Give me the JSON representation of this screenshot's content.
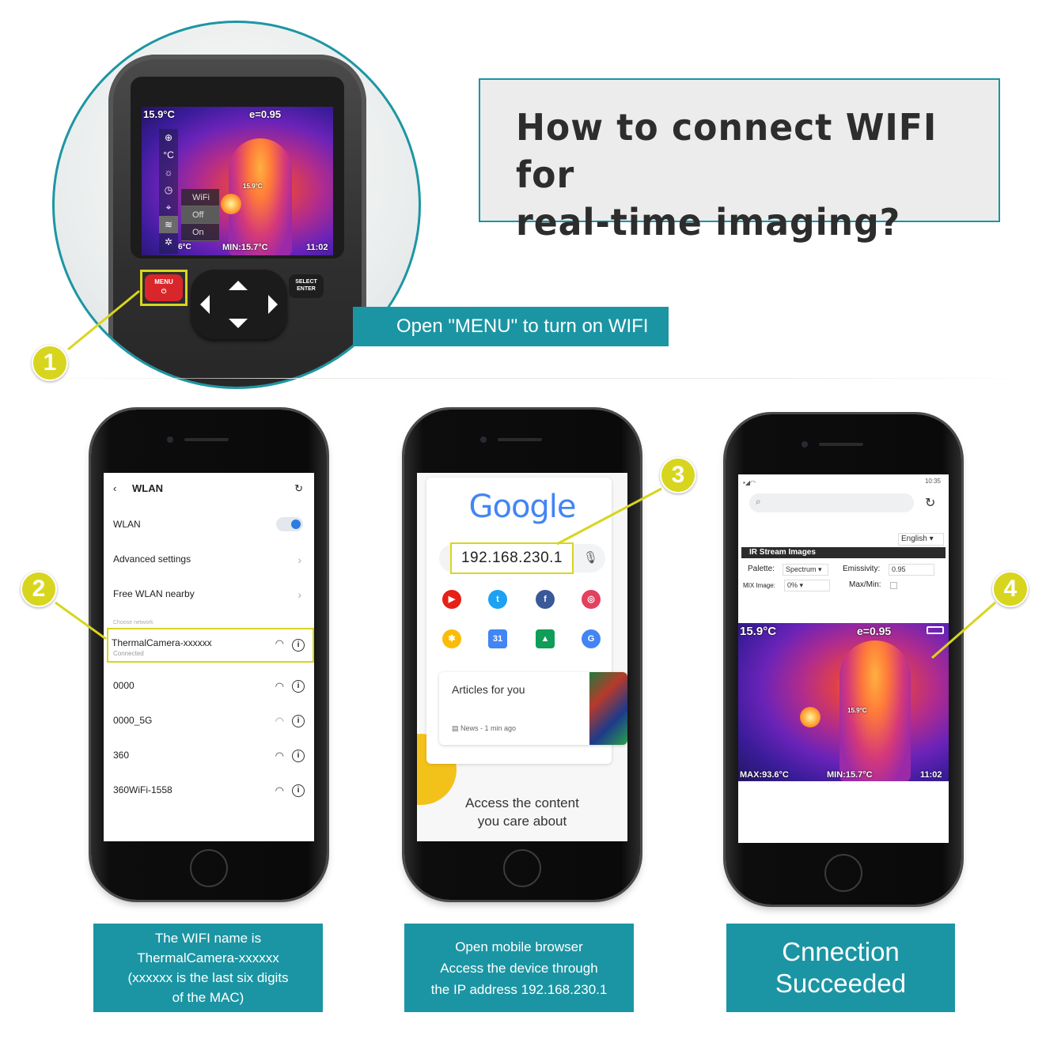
{
  "title": {
    "line1": "How to connect WIFI for",
    "line2": "real-time imaging?"
  },
  "steps": {
    "s1": "1",
    "s2": "2",
    "s3": "3",
    "s4": "4"
  },
  "camera": {
    "banner": "Open \"MENU\" to turn on WIFI",
    "temp": "15.9°C",
    "emissivity": "e=0.95",
    "spot": "15.9°C",
    "min_low": "6°C",
    "min": "MIN:15.7°C",
    "time": "11:02",
    "wifi_menu": [
      "WiFi",
      "Off",
      "On"
    ],
    "menu_button": "MENU",
    "select_button": "SELECT ENTER"
  },
  "phone1": {
    "header": "WLAN",
    "wlan_label": "WLAN",
    "advanced": "Advanced settings",
    "free": "Free WLAN nearby",
    "choose": "Choose network",
    "networks": [
      {
        "name": "ThermalCamera-xxxxxx",
        "sub": "Connected"
      },
      {
        "name": "0000"
      },
      {
        "name": "0000_5G"
      },
      {
        "name": "360"
      },
      {
        "name": "360WiFi-1558"
      }
    ],
    "caption": [
      "The WIFI name is",
      "ThermalCamera-xxxxxx",
      "(xxxxxx is the last six digits",
      "of the MAC)"
    ]
  },
  "phone2": {
    "logo": "Google",
    "ip": "192.168.230.1",
    "article_title": "Articles for you",
    "article_meta": "News - 1 min ago",
    "footer": [
      "Access the content",
      "you care about"
    ],
    "caption": [
      "Open mobile browser",
      "Access the device through",
      "the IP address 192.168.230.1"
    ]
  },
  "phone3": {
    "status_time": "10:35",
    "language": "English",
    "tabs": "IR Stream  Images",
    "palette_label": "Palette:",
    "palette_value": "Spectrum",
    "emissivity_label": "Emissivity:",
    "emissivity_value": "0.95",
    "mix_label": "MIX Image:",
    "mix_value": "0%",
    "maxmin_label": "Max/Min:",
    "temp": "15.9°C",
    "emissivity": "e=0.95",
    "spot": "15.9°C",
    "max": "MAX:93.6°C",
    "min": "MIN:15.7°C",
    "time": "11:02",
    "caption": [
      "Cnnection",
      "Succeeded"
    ]
  },
  "colors": {
    "teal": "#1b95a3",
    "badge": "#d8d51e"
  }
}
